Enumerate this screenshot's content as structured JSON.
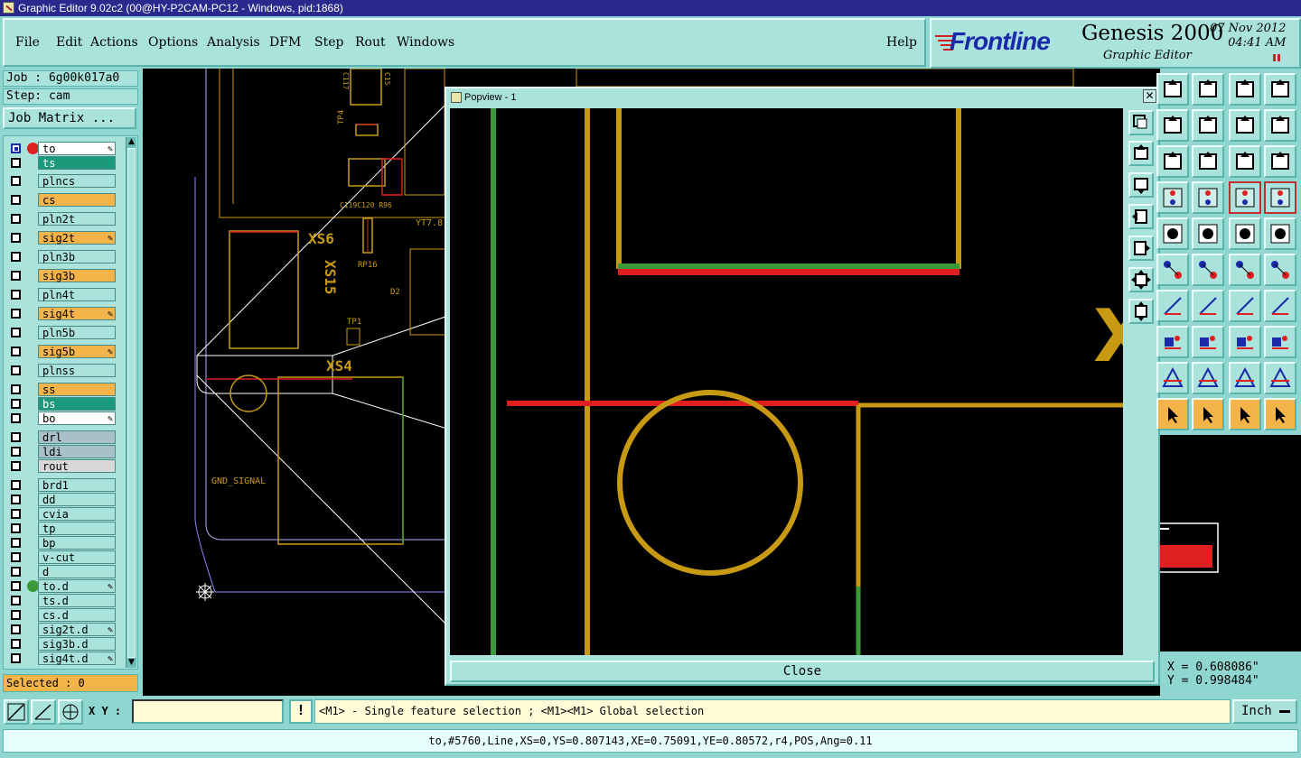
{
  "window": {
    "title": "Graphic Editor 9.02c2 (00@HY-P2CAM-PC12 - Windows, pid:1868)"
  },
  "menu": [
    {
      "label": "File"
    },
    {
      "label": "Edit"
    },
    {
      "label": "Actions"
    },
    {
      "label": "Options"
    },
    {
      "label": "Analysis"
    },
    {
      "label": "DFM"
    },
    {
      "label": "Step"
    },
    {
      "label": "Rout"
    },
    {
      "label": "Windows"
    },
    {
      "label": "Help"
    }
  ],
  "logo": {
    "brand": "Frontline",
    "product": "Genesis 2000",
    "subtitle": "Graphic Editor",
    "date": "07 Nov 2012",
    "time": "04:41 AM"
  },
  "job": {
    "label": "Job : 6g00k017a0",
    "step": "Step: cam",
    "matrix_button": "Job Matrix ..."
  },
  "layers": [
    {
      "name": "to",
      "color": "#ffffff",
      "dot": "#e02020",
      "edit": true,
      "active": true
    },
    {
      "name": "ts",
      "color": "#1a9a7a",
      "dot": null
    },
    {
      "name": "plncs",
      "color": "#a9e3dc",
      "dot": null
    },
    {
      "name": "cs",
      "color": "#f5b44a",
      "dot": null
    },
    {
      "name": "pln2t",
      "color": "#a9e3dc",
      "dot": null
    },
    {
      "name": "sig2t",
      "color": "#f5b44a",
      "dot": null,
      "edit": true
    },
    {
      "name": "pln3b",
      "color": "#a9e3dc",
      "dot": null
    },
    {
      "name": "sig3b",
      "color": "#f5b44a",
      "dot": null
    },
    {
      "name": "pln4t",
      "color": "#a9e3dc",
      "dot": null
    },
    {
      "name": "sig4t",
      "color": "#f5b44a",
      "dot": null,
      "edit": true
    },
    {
      "name": "pln5b",
      "color": "#a9e3dc",
      "dot": null
    },
    {
      "name": "sig5b",
      "color": "#f5b44a",
      "dot": null,
      "edit": true
    },
    {
      "name": "plnss",
      "color": "#a9e3dc",
      "dot": null
    },
    {
      "name": "ss",
      "color": "#f5b44a",
      "dot": null
    },
    {
      "name": "bs",
      "color": "#1a9a7a",
      "dot": null
    },
    {
      "name": "bo",
      "color": "#ffffff",
      "dot": null,
      "edit": true
    },
    {
      "name": "drl",
      "color": "#a8c0c8",
      "dot": null
    },
    {
      "name": "ldi",
      "color": "#a8c0c8",
      "dot": null
    },
    {
      "name": "rout",
      "color": "#d8d8d8",
      "dot": null
    },
    {
      "name": "brd1",
      "color": "#a9e3dc",
      "dot": null
    },
    {
      "name": "dd",
      "color": "#a9e3dc",
      "dot": null
    },
    {
      "name": "cvia",
      "color": "#a9e3dc",
      "dot": null
    },
    {
      "name": "tp",
      "color": "#a9e3dc",
      "dot": null
    },
    {
      "name": "bp",
      "color": "#a9e3dc",
      "dot": null
    },
    {
      "name": "v-cut",
      "color": "#a9e3dc",
      "dot": null
    },
    {
      "name": "d",
      "color": "#a9e3dc",
      "dot": null
    },
    {
      "name": "to.d",
      "color": "#a9e3dc",
      "dot": "#3a9a3a",
      "edit": true
    },
    {
      "name": "ts.d",
      "color": "#a9e3dc",
      "dot": null
    },
    {
      "name": "cs.d",
      "color": "#a9e3dc",
      "dot": null
    },
    {
      "name": "sig2t.d",
      "color": "#a9e3dc",
      "dot": null,
      "edit": true
    },
    {
      "name": "sig3b.d",
      "color": "#a9e3dc",
      "dot": null
    },
    {
      "name": "sig4t.d",
      "color": "#a9e3dc",
      "dot": null,
      "edit": true
    }
  ],
  "selected": "Selected : 0",
  "canvas_labels": [
    "XS6",
    "XS15",
    "XS4",
    "RP16",
    "TP1",
    "D2",
    "TP4",
    "YT7.8",
    "GND_SIGNAL",
    "C119C120 R96",
    "C117",
    "C15"
  ],
  "popview": {
    "title": "Popview - 1",
    "close_label": "Close"
  },
  "coords": {
    "x": "X = 0.608086\"",
    "y": "Y = 0.998484\""
  },
  "xy": {
    "label": "X Y :",
    "value": ""
  },
  "message": "<M1> - Single feature selection ; <M1><M1> Global selection",
  "unit": "Inch",
  "status": "to,#5760,Line,XS=0,YS=0.807143,XE=0.75091,YE=0.80572,r4,POS,Ang=0.11",
  "colors": {
    "accent": "#a9e3dc",
    "highlight": "#f5b44a",
    "trace": "#c89a14",
    "red": "#e02020",
    "green": "#3a9a3a"
  }
}
